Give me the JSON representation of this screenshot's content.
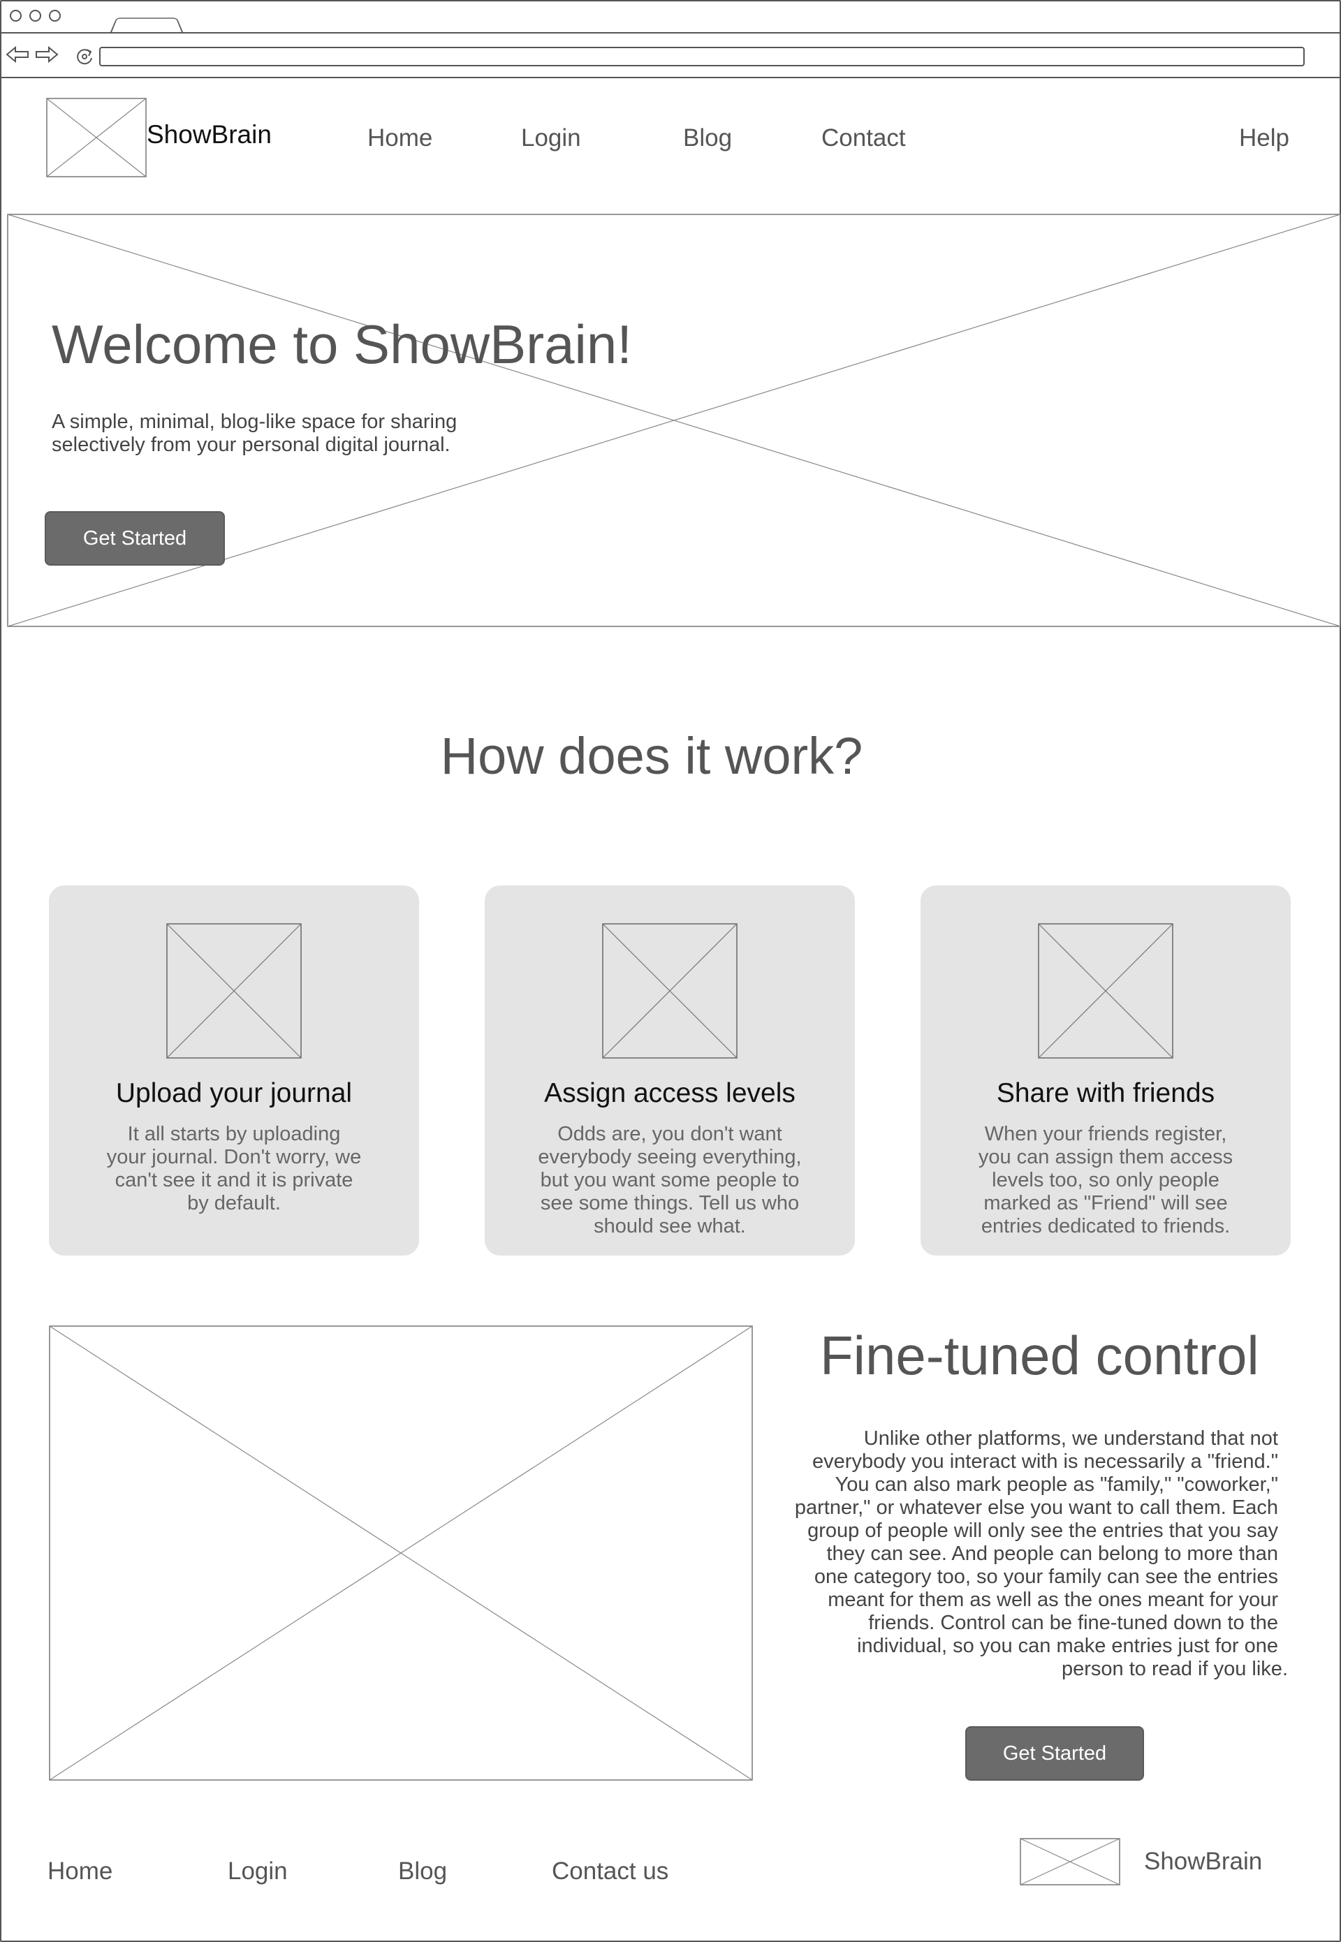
{
  "brand": {
    "name": "ShowBrain"
  },
  "nav": {
    "home": "Home",
    "login": "Login",
    "blog": "Blog",
    "contact": "Contact",
    "help": "Help"
  },
  "hero": {
    "title": "Welcome to ShowBrain!",
    "subtitle_line1": "A simple, minimal, blog-like space for sharing",
    "subtitle_line2": "selectively from your personal digital journal.",
    "cta": "Get Started"
  },
  "how": {
    "title": "How does it work?",
    "cards": [
      {
        "title": "Upload your journal",
        "lines": [
          "It all starts by uploading",
          "your journal. Don't worry, we",
          "can't see it and it is private",
          "by default."
        ]
      },
      {
        "title": "Assign access levels",
        "lines": [
          "Odds are, you don't want",
          "everybody seeing everything,",
          "but you want some people to",
          "see some things. Tell us who",
          "should see what."
        ]
      },
      {
        "title": "Share with friends",
        "lines": [
          "When your friends register,",
          "you can assign them access",
          "levels too, so only people",
          "marked as \"Friend\" will see",
          "entries dedicated to friends."
        ]
      }
    ]
  },
  "finetuned": {
    "title": "Fine-tuned control",
    "lines": [
      "Unlike other platforms, we understand that not",
      "everybody you interact with is necessarily a \"friend.\"",
      "You can also mark people as \"family,\" \"coworker,\"",
      "partner,\" or whatever else you want to call them. Each",
      "group of people will only see the entries that you say",
      "they can see. And people can belong to more than",
      "one category too, so your family can see the entries",
      "meant for them as well as the ones meant for your",
      "friends. Control can be fine-tuned down to the",
      "individual, so you can make entries just for one",
      "person to read if you like."
    ],
    "cta": "Get Started"
  },
  "footer": {
    "home": "Home",
    "login": "Login",
    "blog": "Blog",
    "contact": "Contact us",
    "brand": "ShowBrain"
  },
  "icons": {
    "window_controls": [
      "close-dot-icon",
      "minimize-dot-icon",
      "maximize-dot-icon"
    ],
    "back": "back-arrow-icon",
    "forward": "forward-arrow-icon",
    "reload": "reload-icon",
    "image_placeholder": "image-placeholder-icon"
  }
}
